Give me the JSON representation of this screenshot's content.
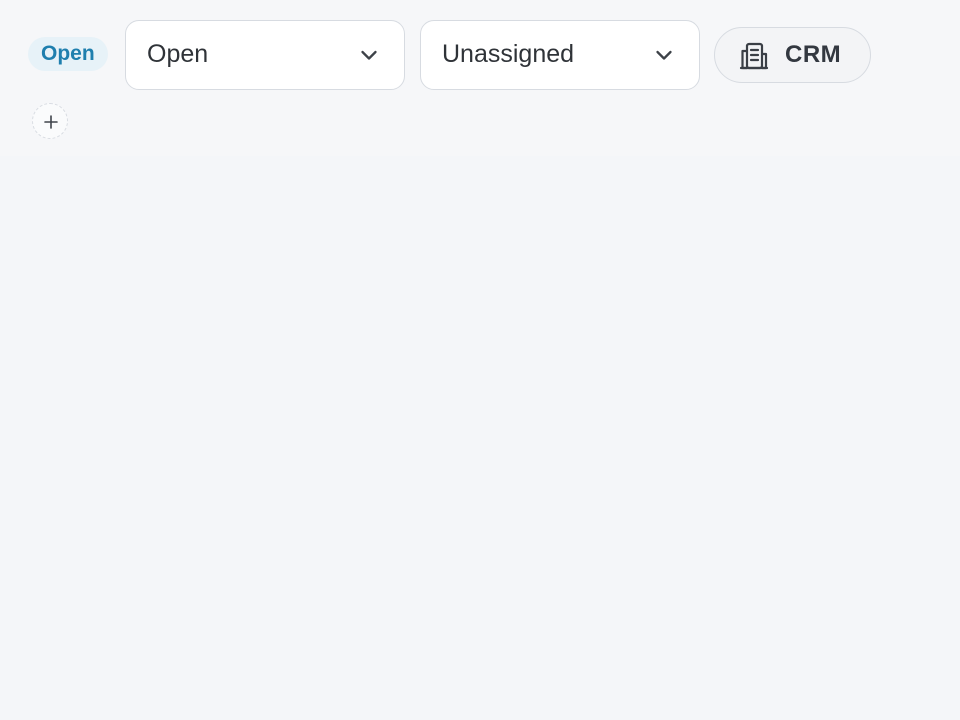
{
  "status_badge": {
    "label": "Open"
  },
  "filters": {
    "status": {
      "selected": "Open",
      "icon": "chevron-down-icon"
    },
    "assignee": {
      "selected": "Unassigned",
      "icon": "chevron-down-icon"
    },
    "crm": {
      "label": "CRM",
      "icon": "building-icon"
    },
    "add": {
      "icon": "plus-icon"
    }
  },
  "colors": {
    "badge_text": "#1f7fae",
    "badge_background": "#e7f2f8",
    "page_background": "#f4f6f9",
    "border": "#d7dbe1"
  }
}
